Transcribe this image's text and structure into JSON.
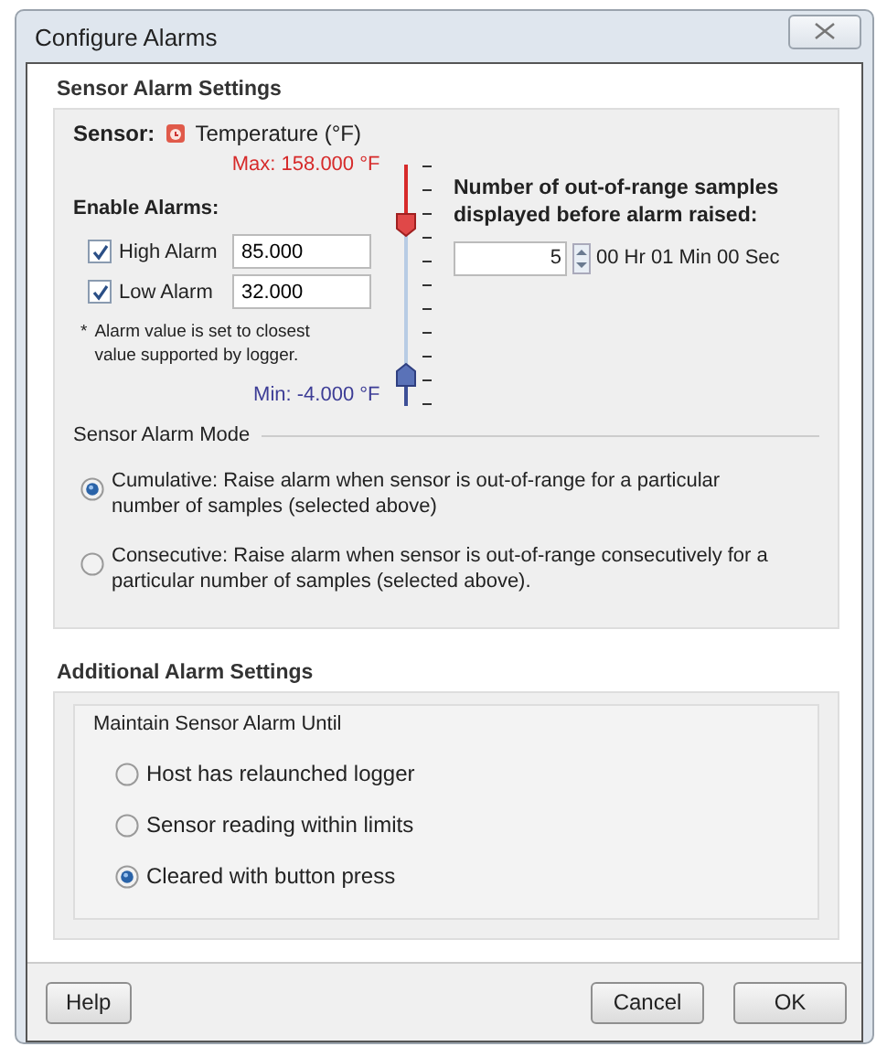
{
  "window": {
    "title": "Configure Alarms"
  },
  "sensor_alarm_settings": {
    "heading": "Sensor Alarm Settings",
    "sensor_label": "Sensor:",
    "sensor_name": "Temperature (°F)",
    "max_label": "Max: 158.000 °F",
    "min_label": "Min: -4.000 °F",
    "enable_heading": "Enable Alarms:",
    "alarms": [
      {
        "label": "High Alarm",
        "checked": true,
        "value": "85.000"
      },
      {
        "label": "Low Alarm",
        "checked": true,
        "value": "32.000"
      }
    ],
    "note_mark": "*",
    "note": "Alarm value is set to closest value supported by logger.",
    "thresholds": [
      {
        "kind": "high",
        "level": 0.75
      },
      {
        "kind": "low",
        "level": 0.13
      }
    ],
    "samples_heading": "Number of out-of-range samples displayed before alarm raised:",
    "samples_value": "5",
    "duration": "00 Hr 01 Min 00 Sec",
    "mode": {
      "legend": "Sensor Alarm Mode",
      "options": [
        {
          "label": "Cumulative: Raise alarm when sensor is out-of-range for a particular number of samples (selected above)",
          "selected": true
        },
        {
          "label": "Consecutive: Raise alarm when sensor is out-of-range consecutively for a particular number of samples (selected above).",
          "selected": false
        }
      ]
    }
  },
  "additional_alarm_settings": {
    "heading": "Additional Alarm Settings",
    "legend": "Maintain Sensor Alarm Until",
    "options": [
      {
        "label": "Host has relaunched logger",
        "selected": false
      },
      {
        "label": "Sensor reading within limits",
        "selected": false
      },
      {
        "label": "Cleared with button press",
        "selected": true
      }
    ]
  },
  "buttons": [
    {
      "label": "Help",
      "kind": "left"
    },
    {
      "label": "Cancel",
      "kind": "right"
    },
    {
      "label": "OK",
      "kind": "right"
    }
  ]
}
